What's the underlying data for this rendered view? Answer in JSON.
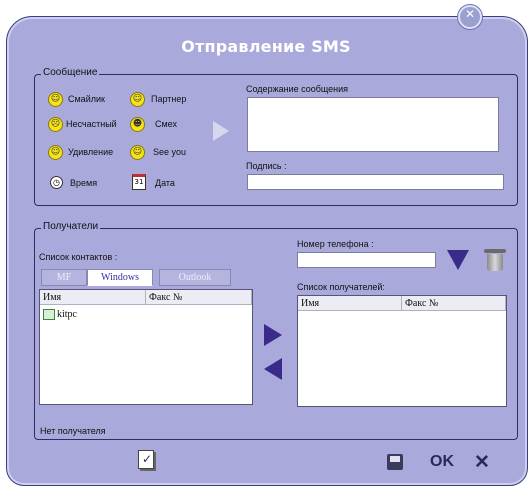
{
  "window": {
    "title": "Отправление SMS",
    "close_glyph": "✕"
  },
  "message_group": {
    "legend": "Сообщение",
    "smileys": [
      {
        "label": "Смайлик",
        "icon": "smiley-icon",
        "glyph": "☺"
      },
      {
        "label": "Партнер",
        "icon": "smiley-icon",
        "glyph": "☺"
      },
      {
        "label": "Несчастный",
        "icon": "sad-smiley-icon",
        "glyph": "☹"
      },
      {
        "label": "Смех",
        "icon": "laugh-smiley-icon",
        "glyph": "☻"
      },
      {
        "label": "Удивление",
        "icon": "surprise-smiley-icon",
        "glyph": "☺"
      },
      {
        "label": "See you",
        "icon": "smiley-icon",
        "glyph": "☺"
      },
      {
        "label": "Время",
        "icon": "clock-icon",
        "glyph": "◷"
      },
      {
        "label": "Дата",
        "icon": "calendar-icon",
        "glyph": "31"
      }
    ],
    "content_label": "Содержание сообщения",
    "content_value": "",
    "signature_label": "Подпись :",
    "signature_value": ""
  },
  "recipients_group": {
    "legend": "Получатели",
    "contacts_label": "Список контактов :",
    "tabs": [
      {
        "label": "MF",
        "active": false
      },
      {
        "label": "Windows",
        "active": true
      },
      {
        "label": "Outlook",
        "active": false
      }
    ],
    "contacts_columns": [
      "Имя",
      "Факс №"
    ],
    "contacts_rows": [
      {
        "name": "kitpc",
        "fax": ""
      }
    ],
    "phone_label": "Номер телефона :",
    "phone_value": "",
    "recipients_label": "Список получателей:",
    "recipients_columns": [
      "Имя",
      "Факс №"
    ],
    "recipients_rows": []
  },
  "status_text": "Нет получателя",
  "bottom": {
    "ok_label": "OK",
    "cancel_glyph": "✕"
  },
  "colors": {
    "window_bg": "#a9a9dc",
    "accent_arrow": "#3a2a8a"
  }
}
